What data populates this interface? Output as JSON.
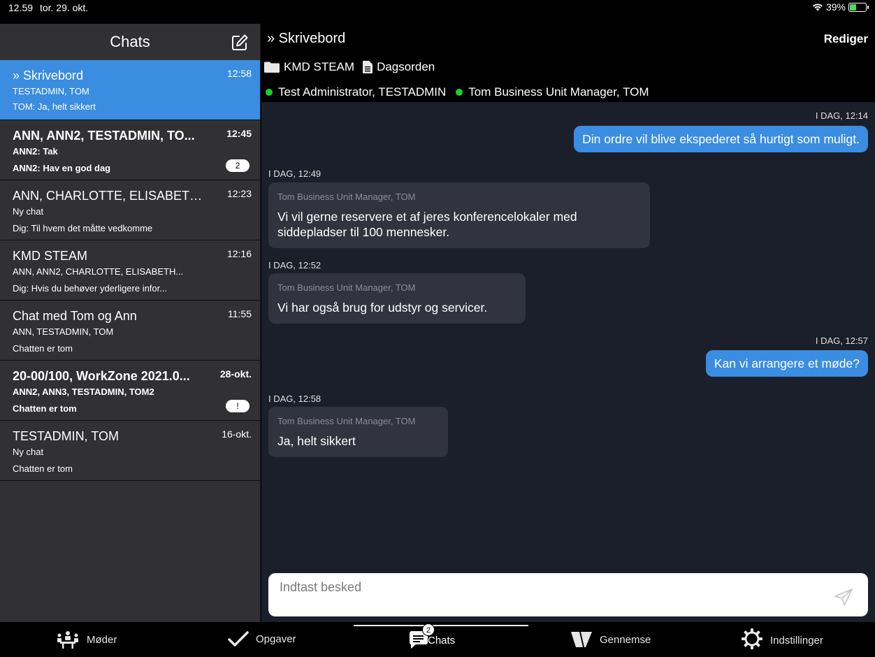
{
  "status": {
    "time": "12.59",
    "date": "tor. 29. okt.",
    "battery": "39%"
  },
  "sidebar": {
    "title": "Chats",
    "chats": [
      {
        "title": "» Skrivebord",
        "time": "12:58",
        "members": "TESTADMIN, TOM",
        "last": "TOM: Ja, helt sikkert",
        "unread": ""
      },
      {
        "title": "ANN, ANN2, TESTADMIN, TO...",
        "time": "12:45",
        "members": "ANN2: Tak",
        "last": "ANN2: Hav en god dag",
        "unread": "2"
      },
      {
        "title": "ANN, CHARLOTTE, ELISABETH...",
        "time": "12:23",
        "members": "Ny chat",
        "last": "Dig: Til hvem det måtte vedkomme",
        "unread": ""
      },
      {
        "title": "KMD STEAM",
        "time": "12:16",
        "members": "ANN, ANN2, CHARLOTTE, ELISABETH...",
        "last": "Dig: Hvis du behøver yderligere infor...",
        "unread": ""
      },
      {
        "title": "Chat med Tom og Ann",
        "time": "11:55",
        "members": "ANN, TESTADMIN, TOM",
        "last": "Chatten er tom",
        "unread": ""
      },
      {
        "title": "20-00/100, WorkZone 2021.0...",
        "time": "28-okt.",
        "members": "ANN2, ANN3, TESTADMIN, TOM2",
        "last": "Chatten er tom",
        "unread": "!"
      },
      {
        "title": "TESTADMIN, TOM",
        "time": "16-okt.",
        "members": "Ny chat",
        "last": "Chatten er tom",
        "unread": ""
      }
    ]
  },
  "conversation": {
    "title": "» Skrivebord",
    "edit_label": "Rediger",
    "folder": "KMD STEAM",
    "document": "Dagsorden",
    "participants": [
      "Test Administrator, TESTADMIN",
      "Tom Business Unit Manager, TOM"
    ],
    "messages": [
      {
        "time": "I DAG, 12:14",
        "sender": "",
        "text": "Din ordre vil blive ekspederet så hurtigt som muligt."
      },
      {
        "time": "I DAG, 12:49",
        "sender": "Tom Business Unit Manager, TOM",
        "text_line1": "Vi vil gerne reservere et af jeres konferencelokaler med",
        "text_line2": "siddepladser til 100 mennesker."
      },
      {
        "time": "I DAG, 12:52",
        "sender": "Tom Business Unit Manager, TOM",
        "text": "Vi har også brug for udstyr og servicer."
      },
      {
        "time": "I DAG, 12:57",
        "sender": "",
        "text": "Kan vi arrangere et møde?"
      },
      {
        "time": "I DAG, 12:58",
        "sender": "Tom Business Unit Manager, TOM",
        "text": "Ja, helt sikkert"
      }
    ],
    "input_placeholder": "Indtast besked"
  },
  "tabbar": {
    "tabs": [
      {
        "label": "Møder",
        "icon": "meeting-icon"
      },
      {
        "label": "Opgaver",
        "icon": "checkmark-icon"
      },
      {
        "label": "Chats",
        "icon": "chat-icon",
        "badge": "2"
      },
      {
        "label": "Gennemse",
        "icon": "browse-icon"
      },
      {
        "label": "Indstillinger",
        "icon": "gear-icon"
      }
    ]
  },
  "colors": {
    "accent": "#3a8de0",
    "online": "#1ed125",
    "sidebar_bg": "#313134",
    "chat_bg": "#1b1f2a"
  }
}
